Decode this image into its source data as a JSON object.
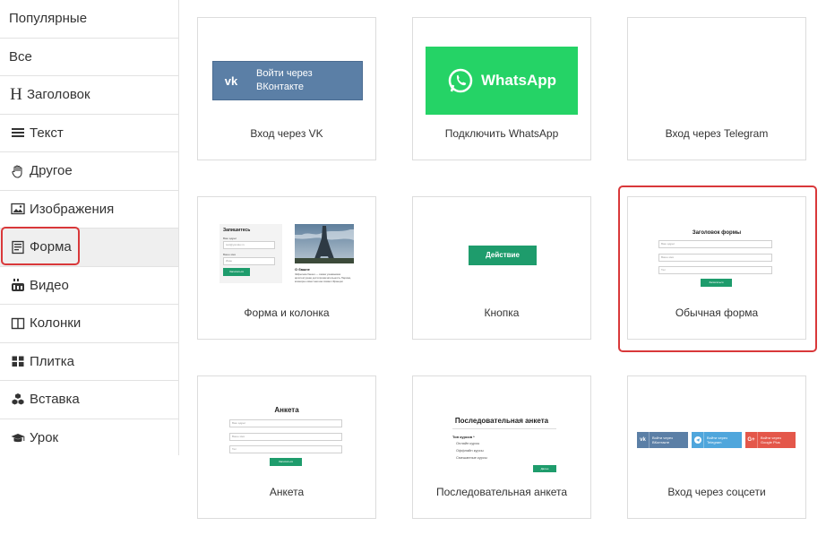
{
  "sidebar": {
    "items": [
      {
        "label": "Популярные",
        "icon": ""
      },
      {
        "label": "Все",
        "icon": ""
      },
      {
        "label": "Заголовок",
        "icon": "heading-icon"
      },
      {
        "label": "Текст",
        "icon": "text-lines-icon"
      },
      {
        "label": "Другое",
        "icon": "hand-icon"
      },
      {
        "label": "Изображения",
        "icon": "image-icon"
      },
      {
        "label": "Форма",
        "icon": "form-icon"
      },
      {
        "label": "Видео",
        "icon": "youtube-icon"
      },
      {
        "label": "Колонки",
        "icon": "columns-icon"
      },
      {
        "label": "Плитка",
        "icon": "tiles-icon"
      },
      {
        "label": "Вставка",
        "icon": "cubes-icon"
      },
      {
        "label": "Урок",
        "icon": "graduation-cap-icon"
      }
    ],
    "heading_glyph": "H"
  },
  "cards": {
    "vk": {
      "label": "Вход через VK",
      "button_logo": "vk",
      "button_text_1": "Войти через",
      "button_text_2": "ВКонтакте",
      "color": "#5b7fa6"
    },
    "whatsapp": {
      "label": "Подключить WhatsApp",
      "button_text": "WhatsApp",
      "color": "#25d366"
    },
    "telegram": {
      "label": "Вход через Telegram"
    },
    "form_column": {
      "label": "Форма и колонка",
      "form_title": "Запишитесь",
      "field1_label": "Ваш адрес",
      "field1_value": "test@yandex.ru",
      "field2_label": "Ваше имя",
      "field2_value": "Иван",
      "button_text": "Записаться",
      "caption_title": "О башне",
      "caption_text": "Эйфелева башня — самая узнаваемая архитектурная достопримечательность Парижа, всемирно известная как символ Франции"
    },
    "button": {
      "label": "Кнопка",
      "button_text": "Действие",
      "color": "#1e9c6c"
    },
    "regular_form": {
      "label": "Обычная форма",
      "form_title": "Заголовок формы",
      "field1": "Ваш адрес",
      "field2": "Ваше имя",
      "field3": "Тел",
      "button_text": "Записаться"
    },
    "survey": {
      "label": "Анкета",
      "form_title": "Анкета",
      "field1": "Ваш адрес",
      "field2": "Ваше имя",
      "field3": "Тел",
      "button_text": "Записаться"
    },
    "sequential_survey": {
      "label": "Последовательная анкета",
      "form_title": "Последовательная анкета",
      "question": "Тип курсов *",
      "option1": "Онлайн курсы",
      "option2": "Оффлайн курсы",
      "option3": "Смешанные курсы",
      "button_text": "Далее"
    },
    "social_login": {
      "label": "Вход через соцсети",
      "vk_text_1": "Войти через",
      "vk_text_2": "ВКонтакте",
      "tg_text_1": "Войти через",
      "tg_text_2": "Telegram",
      "g_text_1": "Войти через",
      "g_text_2": "Google Plus",
      "vk_color": "#5b7fa6",
      "tg_color": "#4fa6dc",
      "g_color": "#e4574a"
    }
  },
  "colors": {
    "highlight": "#d9383a",
    "accent_green": "#1e9c6c",
    "active_bg": "#efefef"
  }
}
